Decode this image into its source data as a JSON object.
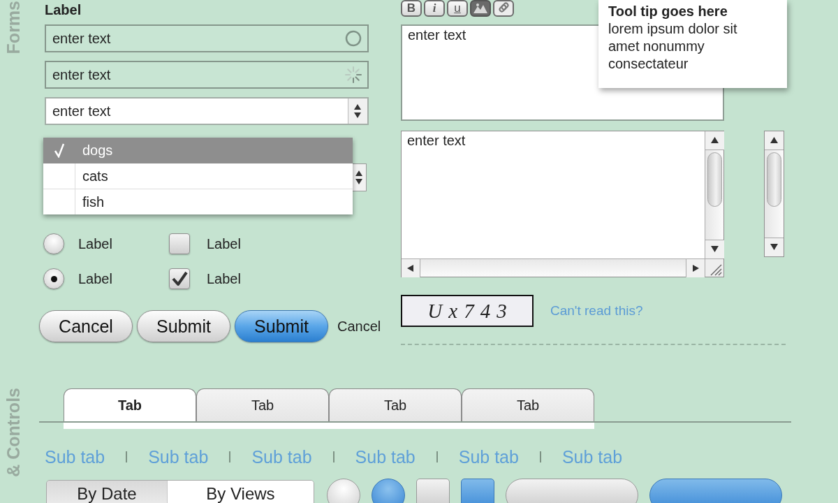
{
  "forms": {
    "heading": "Forms",
    "field_label": "Label",
    "text_fields": [
      {
        "kind": "status",
        "placeholder": "enter text"
      },
      {
        "kind": "loading",
        "placeholder": "enter text"
      },
      {
        "kind": "stepper",
        "placeholder": "enter text"
      }
    ],
    "select": {
      "options": [
        {
          "label": "dogs",
          "selected": true
        },
        {
          "label": "cats",
          "selected": false
        },
        {
          "label": "fish",
          "selected": false
        }
      ]
    },
    "radios": [
      {
        "label": "Label",
        "selected": false
      },
      {
        "label": "Label",
        "selected": true
      }
    ],
    "checkboxes": [
      {
        "label": "Label",
        "checked": false
      },
      {
        "label": "Label",
        "checked": true
      }
    ],
    "buttons": [
      {
        "kind": "plain",
        "label": "Cancel"
      },
      {
        "kind": "plain",
        "label": "Submit"
      },
      {
        "kind": "primary",
        "label": "Submit"
      },
      {
        "kind": "link",
        "label": "Cancel"
      }
    ],
    "editor": {
      "toolbar": [
        {
          "kind": "bold",
          "label": "B"
        },
        {
          "kind": "italic",
          "label": "i"
        },
        {
          "kind": "underline",
          "label": "u"
        },
        {
          "kind": "image"
        },
        {
          "kind": "link"
        }
      ],
      "placeholder": "enter text"
    },
    "tooltip": {
      "title": "Tool tip goes here",
      "body": "lorem ipsum dolor sit amet nonummy consectateur"
    },
    "scroll_textarea": {
      "placeholder": "enter text"
    },
    "captcha": {
      "code": "Ux743",
      "help_link": "Can't read this?"
    }
  },
  "controls": {
    "heading": "& Controls",
    "tabs": [
      {
        "label": "Tab",
        "selected": true
      },
      {
        "label": "Tab",
        "selected": false
      },
      {
        "label": "Tab",
        "selected": false
      },
      {
        "label": "Tab",
        "selected": false
      }
    ],
    "sub_tabs": [
      {
        "label": "Sub tab",
        "selected": false
      },
      {
        "label": "Sub tab",
        "selected": false
      },
      {
        "label": "Sub tab",
        "selected": false
      },
      {
        "label": "Sub tab",
        "selected": false
      },
      {
        "label": "Sub tab",
        "selected": false
      },
      {
        "label": "Sub tab",
        "selected": false
      }
    ],
    "segmented": [
      {
        "label": "By Date",
        "selected": true
      },
      {
        "label": "By Views",
        "selected": false
      }
    ],
    "sample_buttons": [
      {
        "kind": "round",
        "primary": false
      },
      {
        "kind": "round",
        "primary": true
      },
      {
        "kind": "square",
        "primary": false
      },
      {
        "kind": "square",
        "primary": true
      },
      {
        "kind": "pill",
        "primary": false
      },
      {
        "kind": "pill",
        "primary": true
      }
    ]
  }
}
